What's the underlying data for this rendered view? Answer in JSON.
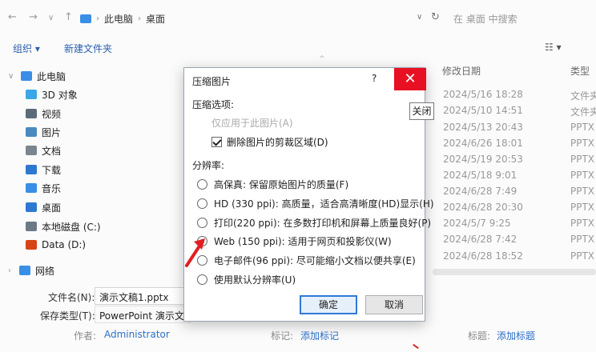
{
  "address": {
    "crumbs": [
      "此电脑",
      "桌面"
    ],
    "search_placeholder": "在 桌面 中搜索"
  },
  "toolbar": {
    "organize_label": "组织 ▾",
    "new_folder_label": "新建文件夹",
    "view_label": "☷ ▾"
  },
  "sidebar": {
    "items": [
      {
        "label": "此电脑",
        "icon": "computer-icon",
        "color": "#3a8ee6"
      },
      {
        "label": "3D 对象",
        "icon": "3d-objects-icon",
        "color": "#3aa7e6"
      },
      {
        "label": "视频",
        "icon": "video-icon",
        "color": "#5b6b7a"
      },
      {
        "label": "图片",
        "icon": "pictures-icon",
        "color": "#4a8ac0"
      },
      {
        "label": "文档",
        "icon": "documents-icon",
        "color": "#7a8590"
      },
      {
        "label": "下载",
        "icon": "downloads-icon",
        "color": "#2f78d0"
      },
      {
        "label": "音乐",
        "icon": "music-icon",
        "color": "#3a8ee6"
      },
      {
        "label": "桌面",
        "icon": "desktop-icon",
        "color": "#2f78d0"
      },
      {
        "label": "本地磁盘 (C:)",
        "icon": "drive-icon",
        "color": "#6c7a88"
      },
      {
        "label": "Data (D:)",
        "icon": "office-drive-icon",
        "color": "#d84315"
      },
      {
        "label": "网络",
        "icon": "network-icon",
        "color": "#3a8ee6"
      }
    ]
  },
  "list": {
    "col_date": "修改日期",
    "col_type": "类型",
    "rows": [
      {
        "date": "2024/5/16 18:28",
        "type": "文件夹"
      },
      {
        "date": "2024/5/10 14:51",
        "type": "文件夹"
      },
      {
        "date": "2024/5/13 20:43",
        "type": "PPTX"
      },
      {
        "date": "2024/6/26 18:01",
        "type": "PPTX"
      },
      {
        "date": "2024/5/19 20:53",
        "type": "PPTX"
      },
      {
        "date": "2024/5/18 9:01",
        "type": "PPTX"
      },
      {
        "date": "2024/6/28 7:49",
        "type": "PPTX"
      },
      {
        "date": "2024/6/28 20:30",
        "type": "PPTX"
      },
      {
        "date": "2024/5/7 9:25",
        "type": "PPTX"
      },
      {
        "date": "2024/6/28 7:42",
        "type": "PPTX"
      },
      {
        "date": "2024/6/28 18:52",
        "type": "PPTX"
      }
    ]
  },
  "form": {
    "filename_label": "文件名(N):",
    "filename_value": "演示文稿1.pptx",
    "filetype_label": "保存类型(T):",
    "filetype_value": "PowerPoint 演示文稿",
    "author_label": "作者:",
    "author_value": "Administrator",
    "tags_label": "标记:",
    "tags_value": "添加标记",
    "title_label": "标题:",
    "title_value": "添加标题"
  },
  "dialog": {
    "title": "压缩图片",
    "help": "?",
    "close_glyph": "✕",
    "close_tooltip": "关闭",
    "compress_section": "压缩选项:",
    "only_this_picture": "仅应用于此图片(A)",
    "delete_cropped": "删除图片的剪裁区域(D)",
    "resolution_section": "分辨率:",
    "options": [
      {
        "label": "高保真: 保留原始图片的质量(F)",
        "selected": false
      },
      {
        "label": "HD (330 ppi): 高质量，适合高清晰度(HD)显示(H)",
        "selected": false
      },
      {
        "label": "打印(220 ppi): 在多数打印机和屏幕上质量良好(P)",
        "selected": false
      },
      {
        "label": "Web (150 ppi): 适用于网页和投影仪(W)",
        "selected": true
      },
      {
        "label": "电子邮件(96 ppi): 尽可能缩小文档以便共享(E)",
        "selected": false
      },
      {
        "label": "使用默认分辨率(U)",
        "selected": false
      }
    ],
    "ok_label": "确定",
    "cancel_label": "取消"
  },
  "colors": {
    "accent": "#2f7ad6",
    "close_red": "#e81123",
    "arrow_red": "#e02020"
  }
}
